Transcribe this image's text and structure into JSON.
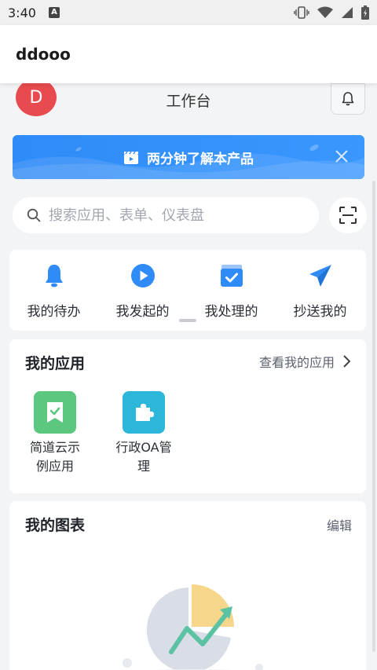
{
  "status_bar": {
    "time": "3:40",
    "notif_letter": "A"
  },
  "header": {
    "title": "ddooo"
  },
  "topbar": {
    "avatar_letter": "D",
    "title": "工作台"
  },
  "banner": {
    "text": "两分钟了解本产品"
  },
  "search": {
    "placeholder": "搜索应用、表单、仪表盘"
  },
  "quick_actions": [
    {
      "label": "我的待办",
      "icon": "bell-icon"
    },
    {
      "label": "我发起的",
      "icon": "play-circle-icon"
    },
    {
      "label": "我处理的",
      "icon": "calendar-check-icon"
    },
    {
      "label": "抄送我的",
      "icon": "paper-plane-icon"
    }
  ],
  "my_apps": {
    "title": "我的应用",
    "link": "查看我的应用",
    "items": [
      {
        "label_line1": "简道云示",
        "label_line2": "例应用",
        "icon": "bookmark-check-icon",
        "color": "#5cc77f"
      },
      {
        "label_line1": "行政OA管",
        "label_line2": "理",
        "icon": "puzzle-icon",
        "color": "#2cb6d9"
      }
    ]
  },
  "my_charts": {
    "title": "我的图表",
    "edit": "编辑"
  },
  "colors": {
    "accent": "#2e8bf7",
    "avatar": "#e84a4f",
    "background": "#f3f4f6"
  }
}
